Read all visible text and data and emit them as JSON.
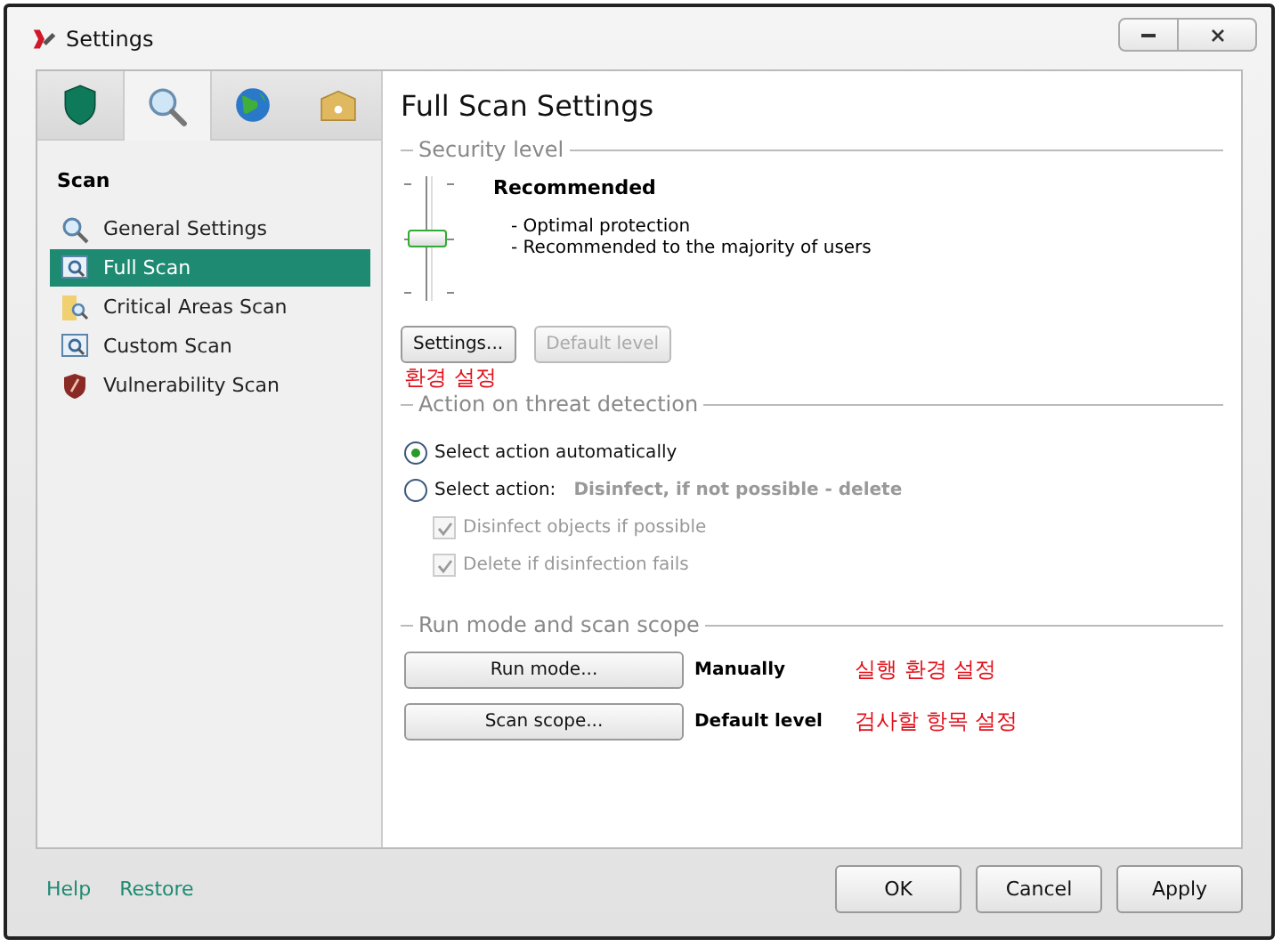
{
  "window": {
    "title": "Settings"
  },
  "tabs": [
    {
      "kind": "shield",
      "selected": false
    },
    {
      "kind": "search",
      "selected": true
    },
    {
      "kind": "globe",
      "selected": false
    },
    {
      "kind": "box",
      "selected": false
    }
  ],
  "sidebar": {
    "heading": "Scan",
    "items": [
      {
        "label": "General Settings",
        "kind": "search",
        "selected": false
      },
      {
        "label": "Full Scan",
        "kind": "monitor",
        "selected": true
      },
      {
        "label": "Critical Areas Scan",
        "kind": "folder",
        "selected": false
      },
      {
        "label": "Custom Scan",
        "kind": "monitor",
        "selected": false
      },
      {
        "label": "Vulnerability Scan",
        "kind": "shield",
        "selected": false
      }
    ]
  },
  "panel": {
    "title": "Full Scan Settings",
    "security_level": {
      "heading": "Security level",
      "level": 0.5,
      "name": "Recommended",
      "description": [
        "- Optimal protection",
        "- Recommended to the majority of users"
      ],
      "buttons": [
        {
          "label": "Settings...",
          "disabled": false
        },
        {
          "label": "Default level",
          "disabled": true
        }
      ],
      "annotation": "환경 설정"
    },
    "threat_action": {
      "heading": "Action on threat detection",
      "radios": [
        {
          "label": "Select action automatically",
          "selected": true
        },
        {
          "label": "Select action:",
          "selected": false,
          "value": "Disinfect, if not possible - delete"
        }
      ],
      "checkboxes": [
        {
          "label": "Disinfect objects if possible",
          "checked": true,
          "disabled": true
        },
        {
          "label": "Delete if disinfection fails",
          "checked": true,
          "disabled": true
        }
      ]
    },
    "run_mode": {
      "heading": "Run mode and scan scope",
      "rows": [
        {
          "button": "Run mode...",
          "value": "Manually",
          "annotation": "실행 환경 설정"
        },
        {
          "button": "Scan scope...",
          "value": "Default level",
          "annotation": "검사할 항목 설정"
        }
      ]
    }
  },
  "footer": {
    "links": [
      "Help",
      "Restore"
    ],
    "buttons": [
      "OK",
      "Cancel",
      "Apply"
    ]
  }
}
